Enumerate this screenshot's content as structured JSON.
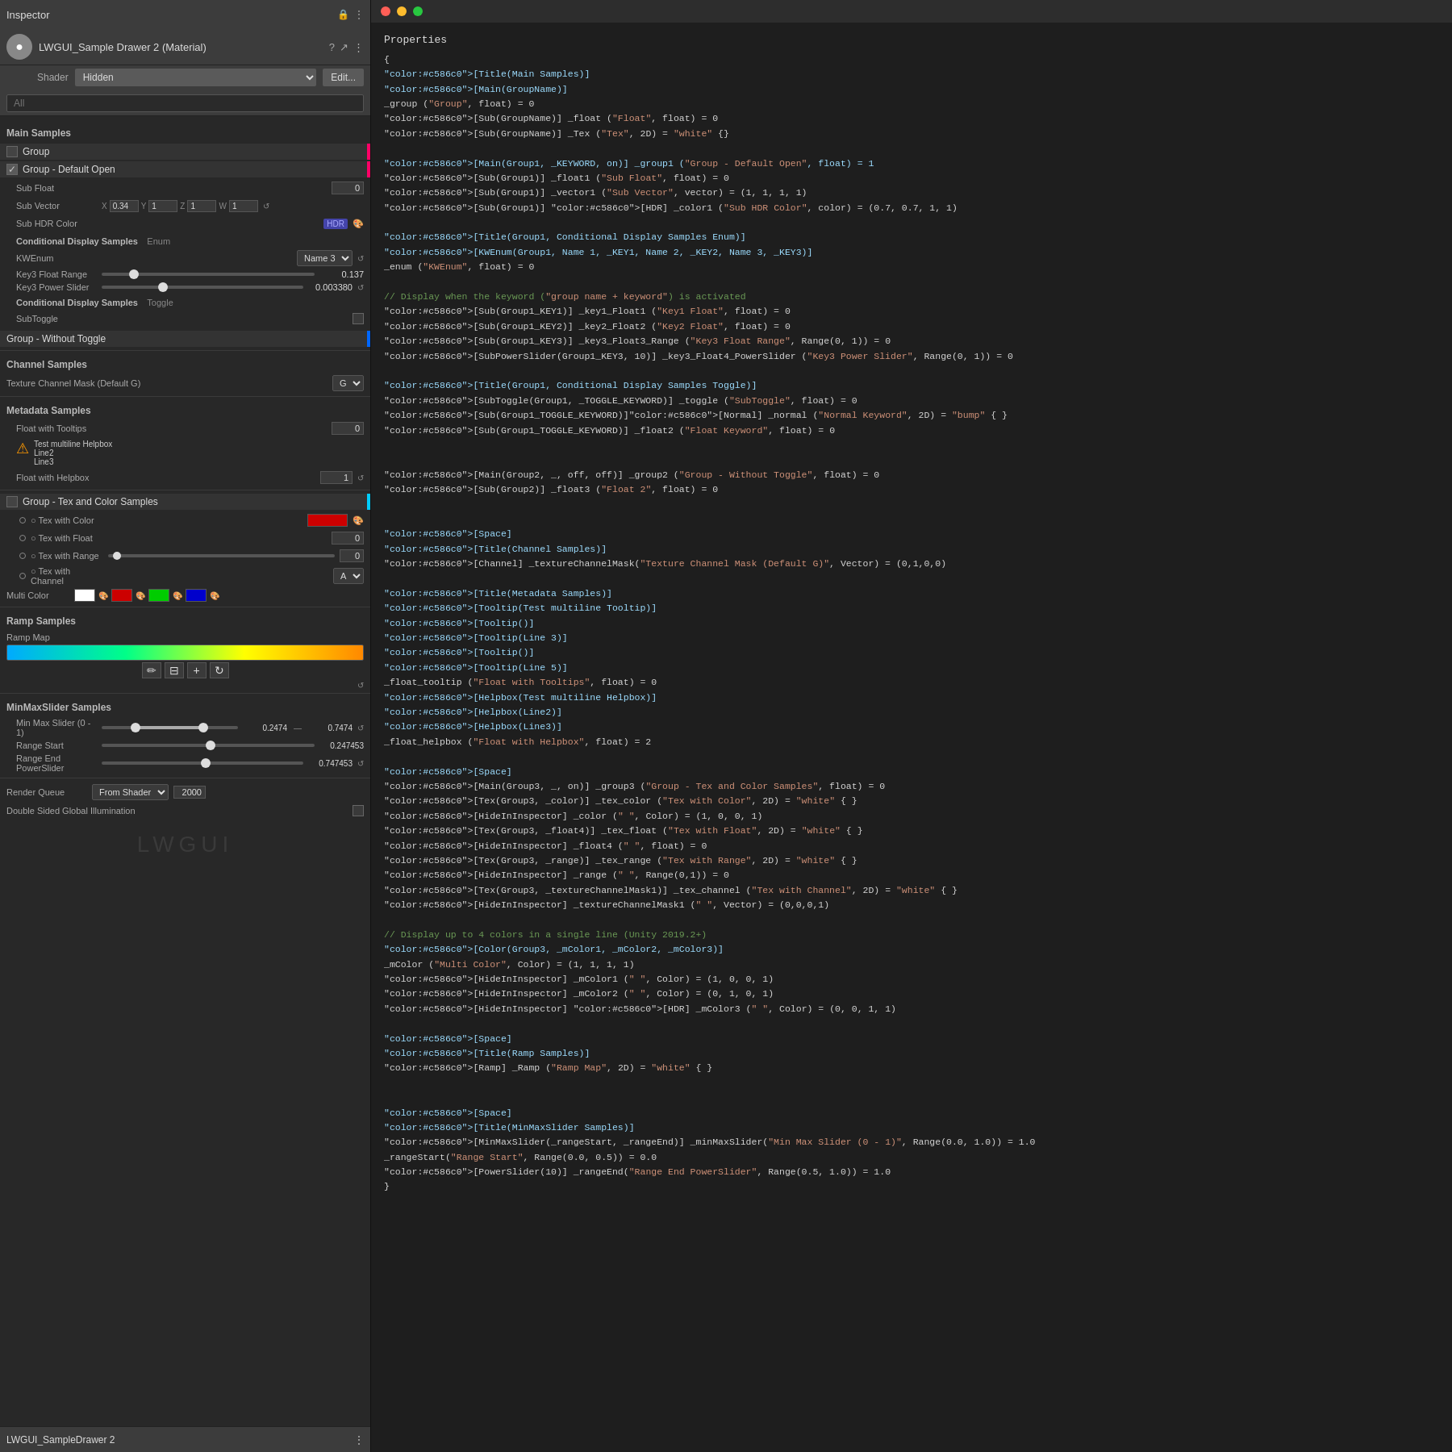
{
  "inspector": {
    "title": "Inspector",
    "material_name": "LWGUI_Sample Drawer 2 (Material)",
    "shader_label": "Shader",
    "shader_value": "Hidden",
    "edit_btn": "Edit...",
    "search_placeholder": "All",
    "sections": {
      "main_samples": "Main Samples",
      "channel_samples": "Channel Samples",
      "metadata_samples": "Metadata Samples",
      "minmax_samples": "MinMaxSlider Samples",
      "ramp_samples": "Ramp Samples",
      "render_queue_label": "Render Queue",
      "double_sided_label": "Double Sided Global Illumination"
    },
    "group": {
      "label": "Group"
    },
    "group_default_open": {
      "label": "Group - Default Open",
      "checked": true,
      "sub_float_label": "Sub Float",
      "sub_float_value": "0",
      "sub_vector_label": "Sub Vector",
      "sub_vector_x": "X",
      "sub_vector_x_val": "0.34",
      "sub_vector_y": "Y",
      "sub_vector_y_val": "1",
      "sub_vector_z": "Z",
      "sub_vector_z_val": "1",
      "sub_vector_w": "W",
      "sub_vector_w_val": "1",
      "sub_hdr_label": "Sub HDR Color",
      "hdr_badge": "HDR"
    },
    "conditional_enum": {
      "label": "Conditional Display Samples",
      "type": "Enum",
      "kwenum_label": "KWEnum",
      "kwenum_value": "Name 3",
      "key3_float_label": "Key3 Float Range",
      "key3_float_value": "0.137",
      "key3_power_label": "Key3 Power Slider",
      "key3_power_value": "0.003380"
    },
    "conditional_toggle": {
      "label": "Conditional Display Samples",
      "type": "Toggle",
      "subtoggle_label": "SubToggle"
    },
    "group_without_toggle": {
      "label": "Group - Without Toggle"
    },
    "texture_channel": {
      "label": "Texture Channel Mask (Default G)",
      "value": "G"
    },
    "float_tooltips": {
      "label": "Float with Tooltips",
      "value": "0",
      "helpbox_line1": "Test multiline Helpbox",
      "helpbox_line2": "Line2",
      "helpbox_line3": "Line3"
    },
    "float_helpbox": {
      "label": "Float with Helpbox",
      "value": "1"
    },
    "group_tex": {
      "label": "Group - Tex and Color Samples",
      "tex_color_label": "○ Tex with Color",
      "tex_float_label": "○ Tex with Float",
      "tex_float_value": "0",
      "tex_range_label": "○ Tex with Range",
      "tex_range_value": "0",
      "tex_channel_label": "○ Tex with Channel",
      "tex_channel_value": "A",
      "multi_color_label": "Multi Color"
    },
    "ramp": {
      "label": "Ramp Map"
    },
    "minmax": {
      "slider_label": "Min Max Slider (0 - 1)",
      "min_val": "0.2474",
      "max_val": "0.7474",
      "range_start_label": "Range Start",
      "range_start_val": "0.247453",
      "range_end_label": "Range End PowerSlider",
      "range_end_val": "0.747453"
    },
    "render_queue": {
      "dropdown_value": "From Shader",
      "number_value": "2000"
    },
    "footer": {
      "name": "LWGUI_SampleDrawer 2",
      "watermark": "LWGUI"
    }
  },
  "code": {
    "title": "Properties",
    "content": [
      {
        "line": "[Title(Main Samples)]",
        "type": "attr"
      },
      {
        "line": "[Main(GroupName)]",
        "type": "attr"
      },
      {
        "line": "_group (\"Group\", float) = 0",
        "type": "normal"
      },
      {
        "line": "[Sub(GroupName)] _float (\"Float\", float) = 0",
        "type": "normal"
      },
      {
        "line": "[Sub(GroupName)] _Tex (\"Tex\", 2D) = \"white\" {}",
        "type": "normal"
      },
      {
        "line": "",
        "type": "empty"
      },
      {
        "line": "[Main(Group1, _KEYWORD, on)] _group1 (\"Group - Default Open\", float) = 1",
        "type": "attr"
      },
      {
        "line": "[Sub(Group1)] _float1 (\"Sub Float\", float) = 0",
        "type": "normal"
      },
      {
        "line": "[Sub(Group1)] _vector1 (\"Sub Vector\", vector) = (1, 1, 1, 1)",
        "type": "normal"
      },
      {
        "line": "[Sub(Group1)] [HDR] _color1 (\"Sub HDR Color\", color) = (0.7, 0.7, 1, 1)",
        "type": "normal"
      },
      {
        "line": "",
        "type": "empty"
      },
      {
        "line": "[Title(Group1, Conditional Display Samples      Enum)]",
        "type": "attr"
      },
      {
        "line": "[KWEnum(Group1, Name 1, _KEY1, Name 2, _KEY2, Name 3, _KEY3)]",
        "type": "attr"
      },
      {
        "line": "_enum (\"KWEnum\", float) = 0",
        "type": "normal"
      },
      {
        "line": "",
        "type": "empty"
      },
      {
        "line": "// Display when the keyword (\"group name + keyword\") is activated",
        "type": "comment"
      },
      {
        "line": "[Sub(Group1_KEY1)] _key1_Float1 (\"Key1 Float\", float) = 0",
        "type": "normal"
      },
      {
        "line": "[Sub(Group1_KEY2)] _key2_Float2 (\"Key2 Float\", float) = 0",
        "type": "normal"
      },
      {
        "line": "[Sub(Group1_KEY3)] _key3_Float3_Range (\"Key3 Float Range\", Range(0, 1)) = 0",
        "type": "normal"
      },
      {
        "line": "[SubPowerSlider(Group1_KEY3, 10)] _key3_Float4_PowerSlider (\"Key3 Power Slider\", Range(0, 1)) = 0",
        "type": "normal"
      },
      {
        "line": "",
        "type": "empty"
      },
      {
        "line": "[Title(Group1, Conditional Display Samples      Toggle)]",
        "type": "attr"
      },
      {
        "line": "[SubToggle(Group1, _TOGGLE_KEYWORD)] _toggle (\"SubToggle\", float) = 0",
        "type": "normal"
      },
      {
        "line": "[Sub(Group1_TOGGLE_KEYWORD)][Normal] _normal (\"Normal Keyword\", 2D) = \"bump\" { }",
        "type": "normal"
      },
      {
        "line": "[Sub(Group1_TOGGLE_KEYWORD)] _float2 (\"Float Keyword\", float) = 0",
        "type": "normal"
      },
      {
        "line": "",
        "type": "empty"
      },
      {
        "line": "",
        "type": "empty"
      },
      {
        "line": "[Main(Group2, _, off, off)] _group2 (\"Group - Without Toggle\", float) = 0",
        "type": "normal"
      },
      {
        "line": "[Sub(Group2)] _float3 (\"Float 2\", float) = 0",
        "type": "normal"
      },
      {
        "line": "",
        "type": "empty"
      },
      {
        "line": "",
        "type": "empty"
      },
      {
        "line": "[Space]",
        "type": "attr"
      },
      {
        "line": "[Title(Channel Samples)]",
        "type": "attr"
      },
      {
        "line": "[Channel] _textureChannelMask(\"Texture Channel Mask (Default G)\", Vector) = (0,1,0,0)",
        "type": "normal"
      },
      {
        "line": "",
        "type": "empty"
      },
      {
        "line": "[Title(Metadata Samples)]",
        "type": "attr"
      },
      {
        "line": "[Tooltip(Test multiline Tooltip)]",
        "type": "attr"
      },
      {
        "line": "[Tooltip()]",
        "type": "attr"
      },
      {
        "line": "[Tooltip(Line 3)]",
        "type": "attr"
      },
      {
        "line": "[Tooltip()]",
        "type": "attr"
      },
      {
        "line": "[Tooltip(Line 5)]",
        "type": "attr"
      },
      {
        "line": "_float_tooltip (\"Float with Tooltips\", float) = 0",
        "type": "normal"
      },
      {
        "line": "[Helpbox(Test multiline Helpbox)]",
        "type": "attr"
      },
      {
        "line": "[Helpbox(Line2)]",
        "type": "attr"
      },
      {
        "line": "[Helpbox(Line3)]",
        "type": "attr"
      },
      {
        "line": "_float_helpbox (\"Float with Helpbox\", float) = 2",
        "type": "normal"
      },
      {
        "line": "",
        "type": "empty"
      },
      {
        "line": "[Space]",
        "type": "attr"
      },
      {
        "line": "[Main(Group3, _, on)] _group3 (\"Group - Tex and Color Samples\", float) = 0",
        "type": "normal"
      },
      {
        "line": "[Tex(Group3, _color)] _tex_color (\"Tex with Color\", 2D) = \"white\" { }",
        "type": "normal"
      },
      {
        "line": "[HideInInspector] _color (\" \", Color) = (1, 0, 0, 1)",
        "type": "normal"
      },
      {
        "line": "[Tex(Group3, _float4)] _tex_float (\"Tex with Float\", 2D) = \"white\" { }",
        "type": "normal"
      },
      {
        "line": "[HideInInspector] _float4 (\" \", float) = 0",
        "type": "normal"
      },
      {
        "line": "[Tex(Group3, _range)] _tex_range (\"Tex with Range\", 2D) = \"white\" { }",
        "type": "normal"
      },
      {
        "line": "[HideInInspector] _range (\" \", Range(0,1)) = 0",
        "type": "normal"
      },
      {
        "line": "[Tex(Group3, _textureChannelMask1)] _tex_channel (\"Tex with Channel\", 2D) = \"white\" { }",
        "type": "normal"
      },
      {
        "line": "[HideInInspector] _textureChannelMask1 (\" \", Vector) = (0,0,0,1)",
        "type": "normal"
      },
      {
        "line": "",
        "type": "empty"
      },
      {
        "line": "// Display up to 4 colors in a single line (Unity 2019.2+)",
        "type": "comment"
      },
      {
        "line": "[Color(Group3, _mColor1, _mColor2, _mColor3)]",
        "type": "attr"
      },
      {
        "line": "_mColor (\"Multi Color\", Color) = (1, 1, 1, 1)",
        "type": "normal"
      },
      {
        "line": "[HideInInspector] _mColor1 (\" \", Color) = (1, 0, 0, 1)",
        "type": "normal"
      },
      {
        "line": "[HideInInspector] _mColor2 (\" \", Color) = (0, 1, 0, 1)",
        "type": "normal"
      },
      {
        "line": "[HideInInspector] [HDR] _mColor3 (\" \", Color) = (0, 0, 1, 1)",
        "type": "normal"
      },
      {
        "line": "",
        "type": "empty"
      },
      {
        "line": "[Space]",
        "type": "attr"
      },
      {
        "line": "[Title(Ramp Samples)]",
        "type": "attr"
      },
      {
        "line": "[Ramp] _Ramp (\"Ramp Map\", 2D) = \"white\" { }",
        "type": "normal"
      },
      {
        "line": "",
        "type": "empty"
      },
      {
        "line": "",
        "type": "empty"
      },
      {
        "line": "[Space]",
        "type": "attr"
      },
      {
        "line": "[Title(MinMaxSlider Samples)]",
        "type": "attr"
      },
      {
        "line": "[MinMaxSlider(_rangeStart, _rangeEnd)] _minMaxSlider(\"Min Max Slider (0 - 1)\", Range(0.0, 1.0)) = 1.0",
        "type": "normal"
      },
      {
        "line": "_rangeStart(\"Range Start\", Range(0.0, 0.5)) = 0.0",
        "type": "normal"
      },
      {
        "line": "[PowerSlider(10)] _rangeEnd(\"Range End PowerSlider\", Range(0.5, 1.0)) = 1.0",
        "type": "normal"
      }
    ]
  }
}
